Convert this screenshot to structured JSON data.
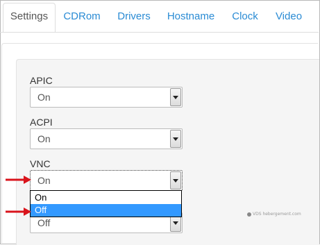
{
  "tabs": [
    {
      "label": "Settings",
      "active": true
    },
    {
      "label": "CDRom",
      "active": false
    },
    {
      "label": "Drivers",
      "active": false
    },
    {
      "label": "Hostname",
      "active": false
    },
    {
      "label": "Clock",
      "active": false
    },
    {
      "label": "Video",
      "active": false
    }
  ],
  "fields": {
    "apic": {
      "label": "APIC",
      "value": "On"
    },
    "acpi": {
      "label": "ACPI",
      "value": "On"
    },
    "vnc": {
      "label": "VNC",
      "value": "On"
    },
    "fourth": {
      "value": "Off"
    }
  },
  "dropdown": {
    "options": [
      {
        "label": "On"
      },
      {
        "label": "Off"
      }
    ],
    "highlighted": "Off"
  },
  "watermark": "VDS hebergement.com",
  "colors": {
    "tab_link": "#2a8bd4",
    "arrow": "#d9141c",
    "highlight": "#3399ff"
  }
}
